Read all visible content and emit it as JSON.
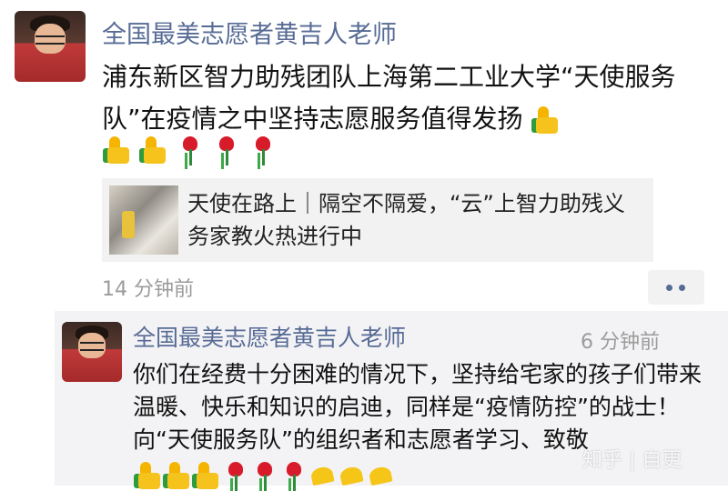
{
  "post": {
    "author": "全国最美志愿者黄吉人老师",
    "text": "浦东新区智力助残团队上海第二工业大学“天使服务队”在疫情之中坚持志愿服务值得发扬",
    "emojis": [
      "thumbs-up",
      "thumbs-up",
      "thumbs-up",
      "rose",
      "rose",
      "rose"
    ],
    "link_title": "天使在路上｜隔空不隔爱，“云”上智力助残义务家教火热进行中",
    "time": "14 分钟前"
  },
  "comment": {
    "author": "全国最美志愿者黄吉人老师",
    "time": "6 分钟前",
    "text": "你们在经费十分困难的情况下，坚持给宅家的孩子们带来温暖、快乐和知识的启迪，同样是“疫情防控”的战士！向“天使服务队”的组织者和志愿者学习、致敬",
    "emojis": [
      "thumbs-up",
      "thumbs-up",
      "thumbs-up",
      "rose",
      "rose",
      "rose",
      "cheer",
      "cheer",
      "cheer"
    ]
  },
  "watermark": "知乎 | 自更",
  "colors": {
    "name": "#576b95",
    "time": "#9b9b9b",
    "comment_bg": "#f3f3f5",
    "link_bg": "#f2f2f2"
  }
}
